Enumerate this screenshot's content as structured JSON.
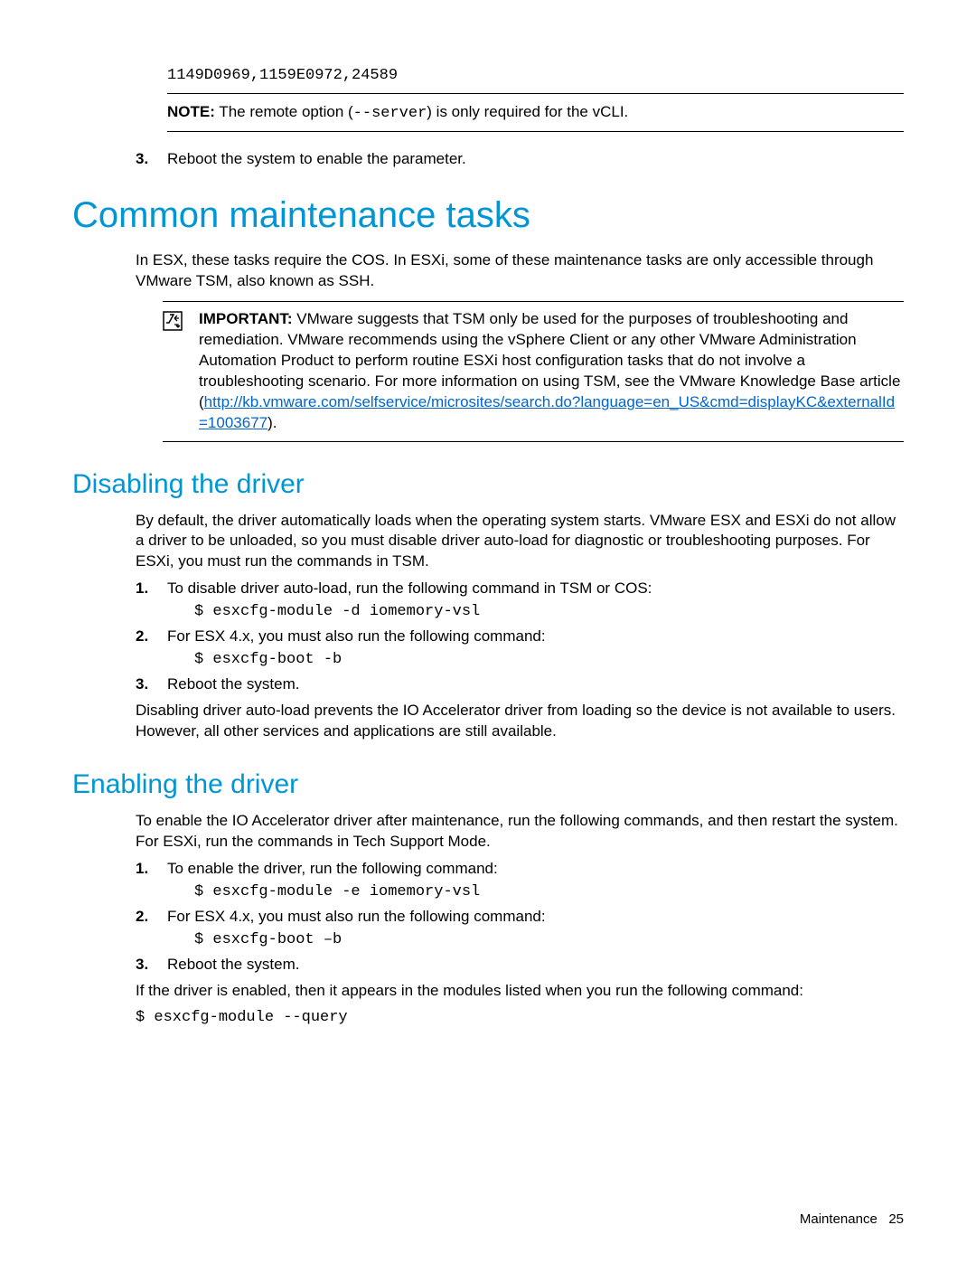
{
  "top": {
    "code": "1149D0969,1159E0972,24589",
    "note_label": "NOTE:",
    "note_text_1": "The remote option (",
    "note_code": "--server",
    "note_text_2": ") is only required for the vCLI.",
    "step3_num": "3.",
    "step3_text": "Reboot the system to enable the parameter."
  },
  "h1": "Common maintenance tasks",
  "intro": "In ESX, these tasks require the COS. In ESXi, some of these maintenance tasks are only accessible through VMware TSM, also known as SSH.",
  "important": {
    "label": "IMPORTANT:",
    "text": "VMware suggests that TSM only be used for the purposes of troubleshooting and remediation. VMware recommends using the vSphere Client or any other VMware Administration Automation Product to perform routine ESXi host configuration tasks that do not involve a troubleshooting scenario. For more information on using TSM, see the VMware Knowledge Base article",
    "link": "http://kb.vmware.com/selfservice/microsites/search.do?language=en_US&cmd=displayKC&externalId=1003677",
    "after_link": ")."
  },
  "disable": {
    "heading": "Disabling the driver",
    "intro": "By default, the driver automatically loads when the operating system starts. VMware ESX and ESXi do not allow a driver to be unloaded, so you must disable driver auto-load for diagnostic or troubleshooting purposes. For ESXi, you must run the commands in TSM.",
    "s1_num": "1.",
    "s1_text": "To disable driver auto-load, run the following command in TSM or COS:",
    "s1_cmd": "$ esxcfg-module -d iomemory-vsl",
    "s2_num": "2.",
    "s2_text": "For ESX 4.x, you must also run the following command:",
    "s2_cmd": "$ esxcfg-boot -b",
    "s3_num": "3.",
    "s3_text": "Reboot the system.",
    "after": "Disabling driver auto-load prevents the IO Accelerator driver from loading so the device is not available to users. However, all other services and applications are still available."
  },
  "enable": {
    "heading": "Enabling the driver",
    "intro": "To enable the IO Accelerator driver after maintenance, run the following commands, and then restart the system. For ESXi, run the commands in Tech Support Mode.",
    "s1_num": "1.",
    "s1_text": "To enable the driver, run the following command:",
    "s1_cmd": "$ esxcfg-module -e iomemory-vsl",
    "s2_num": "2.",
    "s2_text": "For ESX 4.x, you must also run the following command:",
    "s2_cmd": "$ esxcfg-boot –b",
    "s3_num": "3.",
    "s3_text": "Reboot the system.",
    "after": "If the driver is enabled, then it appears in the modules listed when you run the following command:",
    "after_cmd": "$ esxcfg-module --query"
  },
  "footer": {
    "section": "Maintenance",
    "page": "25"
  }
}
